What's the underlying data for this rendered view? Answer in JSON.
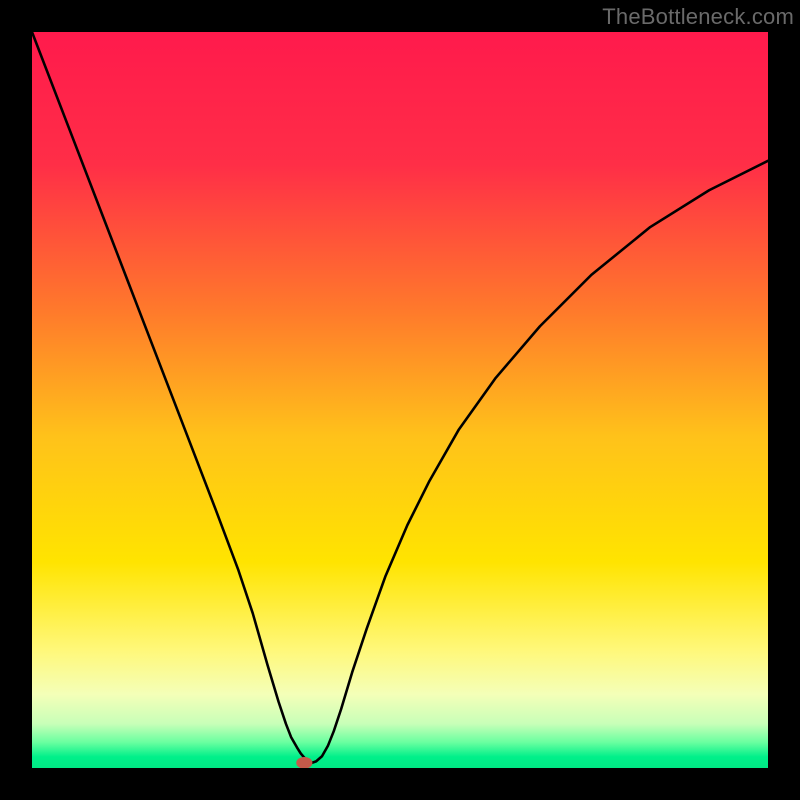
{
  "watermark": "TheBottleneck.com",
  "chart_data": {
    "type": "line",
    "title": "",
    "xlabel": "",
    "ylabel": "",
    "xlim": [
      0,
      100
    ],
    "ylim": [
      0,
      100
    ],
    "background_gradient_stops": [
      {
        "pos": 0.0,
        "color": "#ff1a4c"
      },
      {
        "pos": 0.18,
        "color": "#ff2e47"
      },
      {
        "pos": 0.38,
        "color": "#ff7a2b"
      },
      {
        "pos": 0.55,
        "color": "#ffc21a"
      },
      {
        "pos": 0.72,
        "color": "#ffe400"
      },
      {
        "pos": 0.84,
        "color": "#fff87a"
      },
      {
        "pos": 0.9,
        "color": "#f4ffb8"
      },
      {
        "pos": 0.94,
        "color": "#c8ffb8"
      },
      {
        "pos": 0.965,
        "color": "#6affa0"
      },
      {
        "pos": 0.985,
        "color": "#00f08a"
      },
      {
        "pos": 1.0,
        "color": "#00e884"
      }
    ],
    "series": [
      {
        "name": "curve",
        "x": [
          0,
          5,
          10,
          15,
          20,
          25,
          28,
          30,
          32,
          33.5,
          34.5,
          35.2,
          36,
          36.5,
          37,
          37.5,
          38,
          38.6,
          39.4,
          40.2,
          41,
          42,
          43.5,
          45.5,
          48,
          51,
          54,
          58,
          63,
          69,
          76,
          84,
          92,
          100
        ],
        "y": [
          100,
          87,
          74,
          61,
          48,
          35,
          27,
          21,
          14,
          9,
          6,
          4.2,
          2.8,
          2,
          1.4,
          0.9,
          0.7,
          0.9,
          1.6,
          3,
          5,
          8,
          13,
          19,
          26,
          33,
          39,
          46,
          53,
          60,
          67,
          73.5,
          78.5,
          82.5
        ]
      }
    ],
    "marker": {
      "x": 37.0,
      "y": 0.7,
      "rx": 1.1,
      "ry": 0.8,
      "color": "#c45a4a"
    }
  }
}
